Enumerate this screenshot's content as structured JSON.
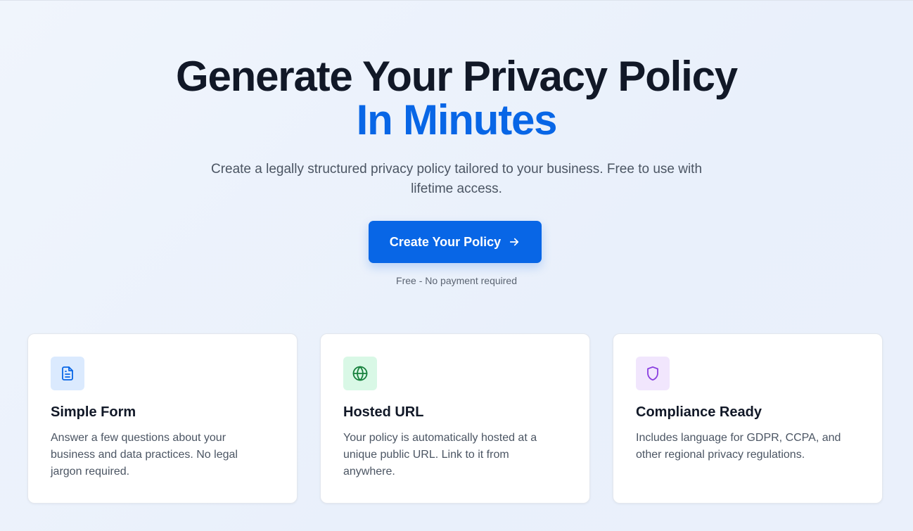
{
  "hero": {
    "headline_line1": "Generate Your Privacy Policy",
    "headline_line2": "In Minutes",
    "subtitle": "Create a legally structured privacy policy tailored to your business. Free to use with lifetime access.",
    "cta_label": "Create Your Policy",
    "cta_icon": "arrow-right-icon",
    "note": "Free - No payment required"
  },
  "features": [
    {
      "icon": "document-icon",
      "icon_bg": "#dbeafe",
      "icon_color": "#0866e6",
      "title": "Simple Form",
      "text": "Answer a few questions about your business and data practices. No legal jargon required."
    },
    {
      "icon": "globe-icon",
      "icon_bg": "#d9f8e6",
      "icon_color": "#16803c",
      "title": "Hosted URL",
      "text": "Your policy is automatically hosted at a unique public URL. Link to it from anywhere."
    },
    {
      "icon": "shield-icon",
      "icon_bg": "#f1e6fd",
      "icon_color": "#8a3ee0",
      "title": "Compliance Ready",
      "text": "Includes language for GDPR, CCPA, and other regional privacy regulations."
    }
  ],
  "colors": {
    "accent": "#0866e6",
    "heading": "#111827",
    "body_text": "#4b5563"
  }
}
